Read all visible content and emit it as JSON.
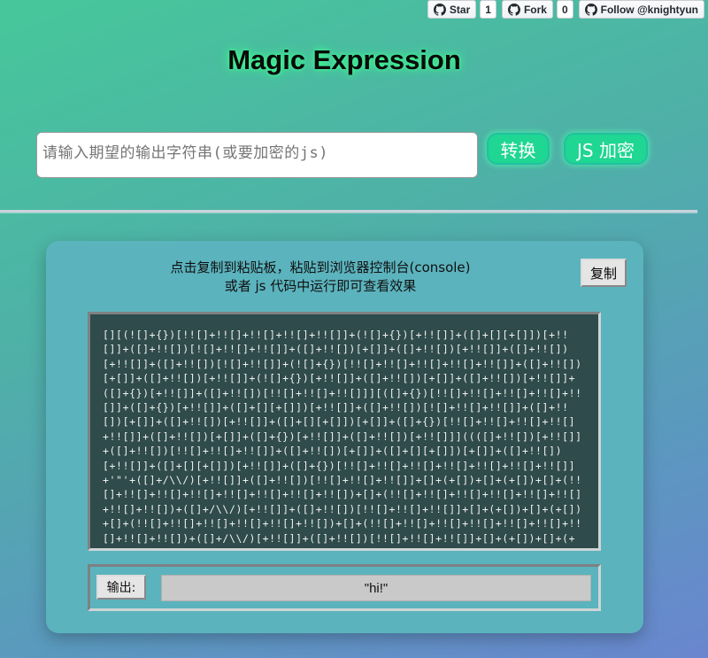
{
  "github": {
    "star_label": "Star",
    "star_count": "1",
    "fork_label": "Fork",
    "fork_count": "0",
    "follow_label": "Follow @knightyun"
  },
  "header": {
    "title": "Magic Expression"
  },
  "converter": {
    "input_value": "",
    "input_placeholder": "请输入期望的输出字符串(或要加密的js)",
    "convert_label": "转换",
    "encrypt_label": "JS 加密"
  },
  "result": {
    "hint_line1": "点击复制到粘贴板，粘贴到浏览器控制台(console)",
    "hint_line2": "或者 js 代码中运行即可查看效果",
    "copy_label": "复制",
    "code": "[][(![]+{})[!![]+!![]+!![]+!![]+!![]]+(![]+{})[+!![]]+([]+[][+[]])[+!![]]+([]+!![])[![]+!![]+!![]]+([]+!![])[+[]]+([]+!![])[+!![]]+([]+!![])[+!![]]+([]+!![])[![]+!![]]+(![]+{})[!![]+!![]+!![]+!![]+!![]]+([]+!![])[+[]]+([]+!![])[+!![]]+(![]+{})[+!![]]+([]+!![])[+[]]+([]+!![])[+!![]]+([]+{})[+!![]]+([]+!![])[!![]+!![]+!![]]][([]+{})[!![]+!![]+!![]+!![]+!![]]+([]+{})[+!![]]+([]+[][+[]])[+!![]]+([]+!![])[![]+!![]+!![]]+([]+!![])[+[]]+([]+!![])[+!![]]+([]+[][+[]])[+[]]+([]+{})[!![]+!![]+!![]+!![]+!![]]+([]+!![])[+[]]+([]+{})[+!![]]+([]+!![])[+!![]]]((([]+!![])[+!![]]+([]+!![])[!![]+!![]+!![]]+([]+!![])[+[]]+([]+[][+[]])[+[]]+([]+!![])[+!![]]+([]+[][+[]])[+!![]]+([]+{})[!![]+!![]+!![]+!![]+!![]+!![]+!![]]+'\"'+([]+/\\\\/)[+!![]]+([]+!![])[!![]+!![]+!![]]+[]+(+[])+[]+(+[])+[]+(!![]+!![]+!![]+!![]+!![]+!![]+!![]+!![])+[]+(!![]+!![]+!![]+!![]+!![]+!![]+!![]+!![])+([]+/\\\\/)[+!![]]+([]+!![])[!![]+!![]+!![]]+[]+(+[])+[]+(+[])+[]+(!![]+!![]+!![]+!![]+!![]+!![])+[]+(!![]+!![]+!![]+!![]+!![]+!![]+!![]+!![]+!![])+([]+/\\\\/)[+!![]]+([]+!![])[!![]+!![]+!![]]+[]+(+[])+[]+(+[])+[]+(!![]+!![])+[]+(+!![])+'\"'))()"
  },
  "output": {
    "label": "输出:",
    "value": "\"hi!\""
  },
  "colors": {
    "accent": "#1fd692",
    "code_bg": "#2f4b4c",
    "card_bg": "#5bb3bd"
  }
}
